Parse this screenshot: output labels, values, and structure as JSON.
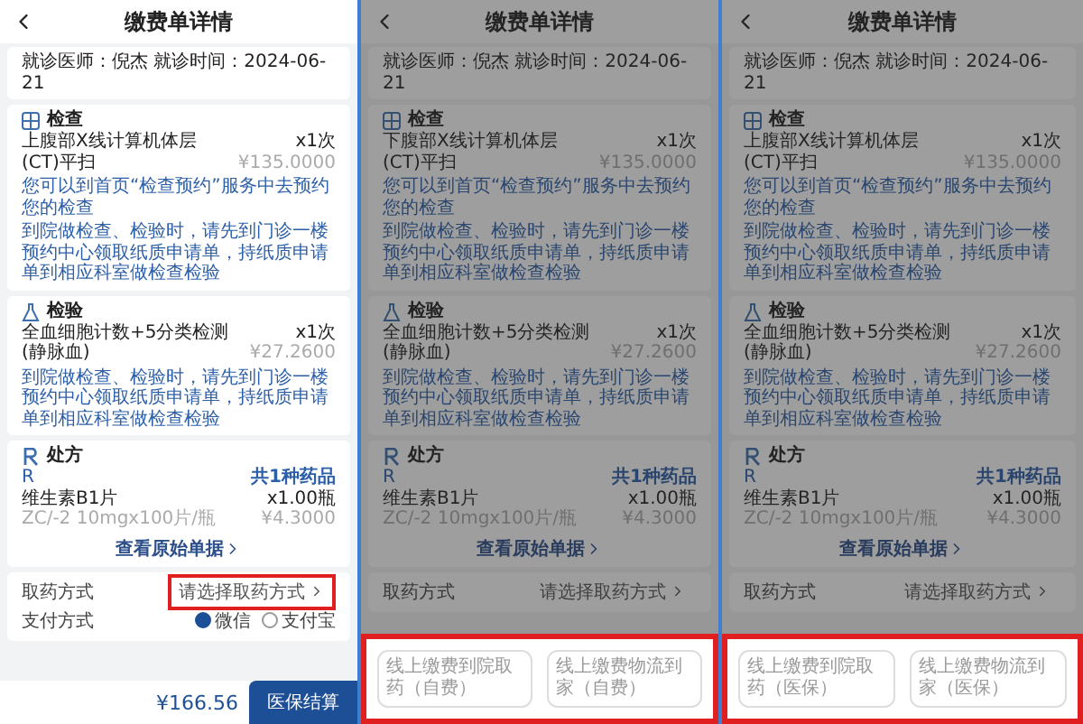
{
  "screens": [
    {
      "dimmed": false,
      "title": "缴费单详情",
      "visit_info": "就诊医师：倪杰 就诊时间：2024-06-21",
      "sections": [
        {
          "kind": "exam",
          "title": "检查",
          "items": [
            {
              "name": "上腹部X线计算机体层(CT)平扫",
              "qty": "x1次",
              "price": "¥135.0000"
            }
          ],
          "notices": [
            "您可以到首页“检查预约”服务中去预约您的检查",
            "到院做检查、检验时，请先到门诊一楼预约中心领取纸质申请单，持纸质申请单到相应科室做检查检验"
          ]
        },
        {
          "kind": "lab",
          "title": "检验",
          "items": [
            {
              "name": "全血细胞计数+5分类检测(静脉血)",
              "qty": "x1次",
              "price": "¥27.2600"
            }
          ],
          "notices": [
            "到院做检查、检验时，请先到门诊一楼预约中心领取纸质申请单，持纸质申请单到相应科室做检查检验"
          ]
        },
        {
          "kind": "prescription",
          "title": "处方",
          "rx": "R",
          "count": "共1种药品",
          "items": [
            {
              "name": "维生素B1片",
              "qty": "x1.00瓶",
              "spec": "ZC/-2 10mgx100片/瓶",
              "price": "¥4.3000"
            }
          ],
          "link": "查看原始单据"
        }
      ],
      "pickup": {
        "label": "取药方式",
        "value": "请选择取药方式",
        "highlighted": true
      },
      "payment": {
        "label": "支付方式",
        "options": [
          {
            "label": "微信",
            "selected": true
          },
          {
            "label": "支付宝",
            "selected": false
          }
        ]
      },
      "footer": {
        "total": "¥166.56",
        "button": "医保结算"
      }
    },
    {
      "dimmed": true,
      "title": "缴费单详情",
      "visit_info": "就诊医师：倪杰 就诊时间：2024-06-21",
      "sections": [
        {
          "kind": "exam",
          "title": "检查",
          "items": [
            {
              "name": "下腹部X线计算机体层(CT)平扫",
              "qty": "x1次",
              "price": "¥135.0000"
            }
          ],
          "notices": [
            "您可以到首页“检查预约”服务中去预约您的检查",
            "到院做检查、检验时，请先到门诊一楼预约中心领取纸质申请单，持纸质申请单到相应科室做检查检验"
          ]
        },
        {
          "kind": "lab",
          "title": "检验",
          "items": [
            {
              "name": "全血细胞计数+5分类检测(静脉血)",
              "qty": "x1次",
              "price": "¥27.2600"
            }
          ],
          "notices": [
            "到院做检查、检验时，请先到门诊一楼预约中心领取纸质申请单，持纸质申请单到相应科室做检查检验"
          ]
        },
        {
          "kind": "prescription",
          "title": "处方",
          "rx": "R",
          "count": "共1种药品",
          "items": [
            {
              "name": "维生素B1片",
              "qty": "x1.00瓶",
              "spec": "ZC/-2 10mgx100片/瓶",
              "price": "¥4.3000"
            }
          ],
          "link": "查看原始单据"
        }
      ],
      "pickup": {
        "label": "取药方式",
        "value": "请选择取药方式",
        "highlighted": false
      },
      "sheet": {
        "highlighted": true,
        "options": [
          "线上缴费到院取药（自费）",
          "线上缴费物流到家（自费）"
        ]
      }
    },
    {
      "dimmed": true,
      "title": "缴费单详情",
      "visit_info": "就诊医师：倪杰 就诊时间：2024-06-21",
      "sections": [
        {
          "kind": "exam",
          "title": "检查",
          "items": [
            {
              "name": "上腹部X线计算机体层(CT)平扫",
              "qty": "x1次",
              "price": "¥135.0000"
            }
          ],
          "notices": [
            "您可以到首页“检查预约”服务中去预约您的检查",
            "到院做检查、检验时，请先到门诊一楼预约中心领取纸质申请单，持纸质申请单到相应科室做检查检验"
          ]
        },
        {
          "kind": "lab",
          "title": "检验",
          "items": [
            {
              "name": "全血细胞计数+5分类检测(静脉血)",
              "qty": "x1次",
              "price": "¥27.2600"
            }
          ],
          "notices": [
            "到院做检查、检验时，请先到门诊一楼预约中心领取纸质申请单，持纸质申请单到相应科室做检查检验"
          ]
        },
        {
          "kind": "prescription",
          "title": "处方",
          "rx": "R",
          "count": "共1种药品",
          "items": [
            {
              "name": "维生素B1片",
              "qty": "x1.00瓶",
              "spec": "ZC/-2 10mgx100片/瓶",
              "price": "¥4.3000"
            }
          ],
          "link": "查看原始单据"
        }
      ],
      "pickup": {
        "label": "取药方式",
        "value": "请选择取药方式",
        "highlighted": false
      },
      "sheet": {
        "highlighted": true,
        "options": [
          "线上缴费到院取药（医保）",
          "线上缴费物流到家（医保）"
        ]
      }
    }
  ]
}
